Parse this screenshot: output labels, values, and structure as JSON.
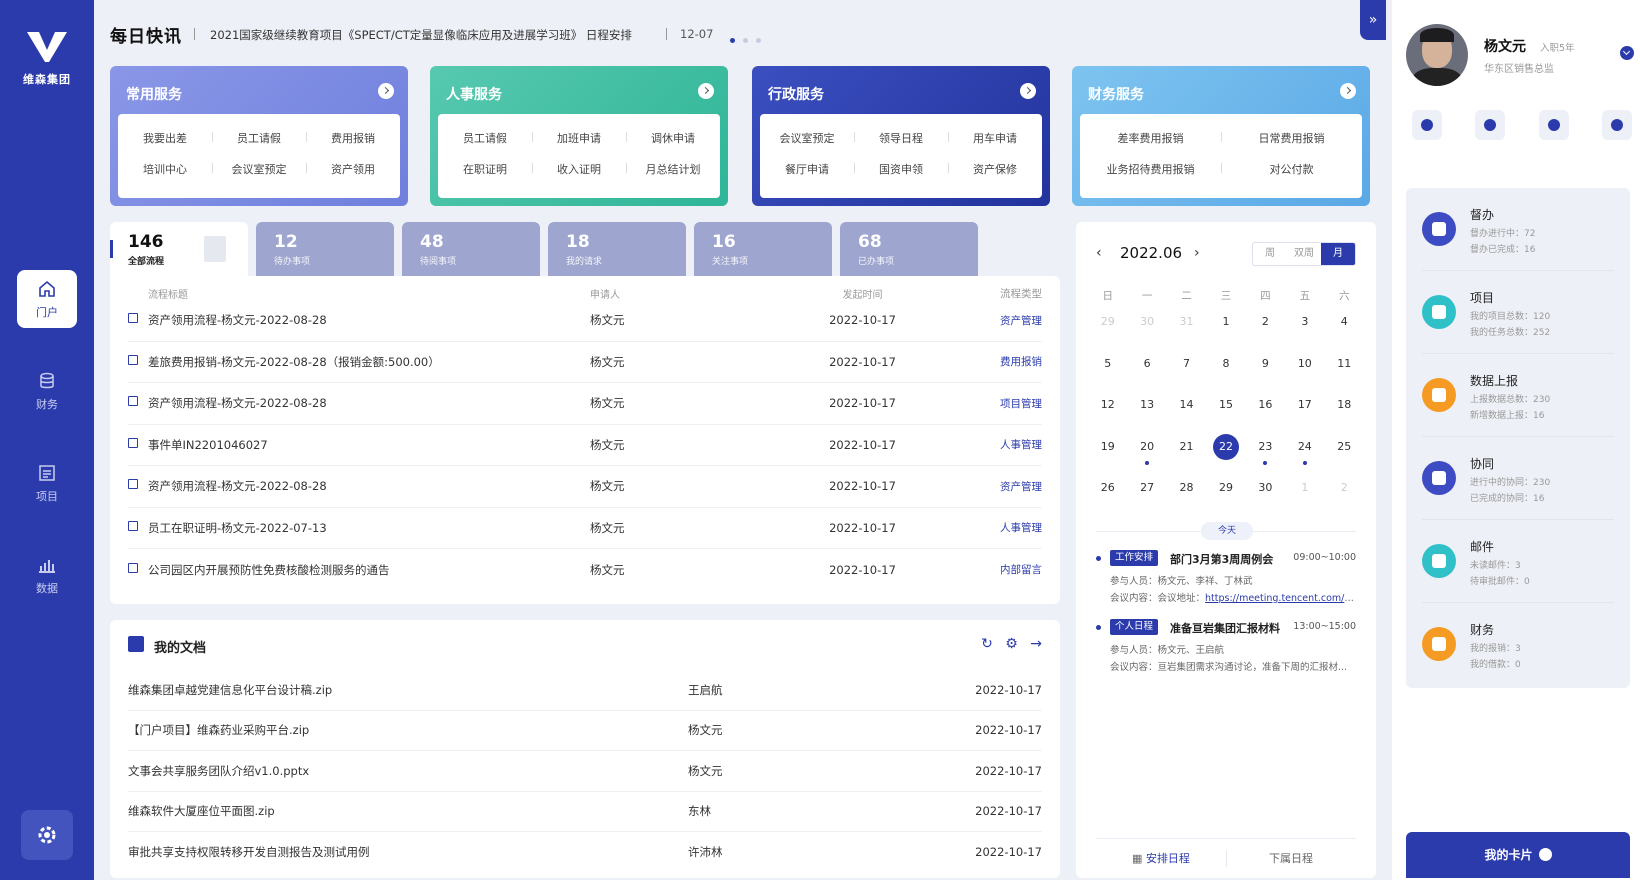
{
  "brand": {
    "logo_text": "维森集团"
  },
  "leftnav": {
    "items": [
      {
        "label": "门户",
        "icon": "home-icon",
        "active": true
      },
      {
        "label": "财务",
        "icon": "database-icon",
        "active": false
      },
      {
        "label": "项目",
        "icon": "project-icon",
        "active": false
      },
      {
        "label": "数据",
        "icon": "bar-chart-icon",
        "active": false
      }
    ],
    "settings_icon": "gear-icon"
  },
  "news": {
    "title": "每日快讯",
    "text": "2021国家级继续教育项目《SPECT/CT定量显像临床应用及进展学习班》 日程安排",
    "date": "12-07"
  },
  "expand_label": "»",
  "services": [
    {
      "title": "常用服务",
      "links": [
        [
          "我要出差",
          "员工请假",
          "费用报销"
        ],
        [
          "培训中心",
          "会议室预定",
          "资产领用"
        ]
      ]
    },
    {
      "title": "人事服务",
      "links": [
        [
          "员工请假",
          "加班申请",
          "调休申请"
        ],
        [
          "在职证明",
          "收入证明",
          "月总结计划"
        ]
      ]
    },
    {
      "title": "行政服务",
      "links": [
        [
          "会议室预定",
          "领导日程",
          "用车申请"
        ],
        [
          "餐厅申请",
          "国资申领",
          "资产保修"
        ]
      ]
    },
    {
      "title": "财务服务",
      "links": [
        [
          "差率费用报销",
          "日常费用报销"
        ],
        [
          "业务招待费用报销",
          "对公付款"
        ]
      ]
    }
  ],
  "process_tabs": [
    {
      "num": "146",
      "label": "全部流程",
      "active": true
    },
    {
      "num": "12",
      "label": "待办事项"
    },
    {
      "num": "48",
      "label": "待阅事项"
    },
    {
      "num": "18",
      "label": "我的请求"
    },
    {
      "num": "16",
      "label": "关注事项"
    },
    {
      "num": "68",
      "label": "已办事项"
    }
  ],
  "process_table": {
    "headers": {
      "title": "流程标题",
      "user": "申请人",
      "time": "发起时间",
      "type": "流程类型"
    },
    "rows": [
      {
        "title": "资产领用流程-杨文元-2022-08-28",
        "user": "杨文元",
        "time": "2022-10-17",
        "type": "资产管理"
      },
      {
        "title": "差旅费用报销-杨文元-2022-08-28（报销金额:500.00）",
        "user": "杨文元",
        "time": "2022-10-17",
        "type": "费用报销"
      },
      {
        "title": "资产领用流程-杨文元-2022-08-28",
        "user": "杨文元",
        "time": "2022-10-17",
        "type": "项目管理"
      },
      {
        "title": "事件单IN2201046027",
        "user": "杨文元",
        "time": "2022-10-17",
        "type": "人事管理"
      },
      {
        "title": "资产领用流程-杨文元-2022-08-28",
        "user": "杨文元",
        "time": "2022-10-17",
        "type": "资产管理"
      },
      {
        "title": "员工在职证明-杨文元-2022-07-13",
        "user": "杨文元",
        "time": "2022-10-17",
        "type": "人事管理"
      },
      {
        "title": "公司园区内开展预防性免费核酸检测服务的通告",
        "user": "杨文元",
        "time": "2022-10-17",
        "type": "内部留言"
      }
    ]
  },
  "docs": {
    "title": "我的文档",
    "tools": [
      "↻",
      "⚙",
      "→"
    ],
    "rows": [
      {
        "name": "维森集团卓越党建信息化平台设计稿.zip",
        "user": "王启航",
        "date": "2022-10-17"
      },
      {
        "name": "【门户项目】维森药业采购平台.zip",
        "user": "杨文元",
        "date": "2022-10-17"
      },
      {
        "name": "文事会共享服务团队介绍v1.0.pptx",
        "user": "杨文元",
        "date": "2022-10-17"
      },
      {
        "name": "维森软件大厦座位平面图.zip",
        "user": "东林",
        "date": "2022-10-17"
      },
      {
        "name": "审批共享支持权限转移开发自测报告及测试用例",
        "user": "许沛林",
        "date": "2022-10-17"
      }
    ]
  },
  "calendar": {
    "month": "2022.06",
    "prev": "‹",
    "next": "›",
    "views": [
      "周",
      "双周",
      "月"
    ],
    "active_view": "月",
    "weekdays": [
      "日",
      "一",
      "二",
      "三",
      "四",
      "五",
      "六"
    ],
    "weeks": [
      [
        [
          "29",
          "muted"
        ],
        [
          "30",
          "muted"
        ],
        [
          "31",
          "muted"
        ],
        [
          "1",
          ""
        ],
        [
          "2",
          ""
        ],
        [
          "3",
          ""
        ],
        [
          "4",
          ""
        ]
      ],
      [
        [
          "5",
          ""
        ],
        [
          "6",
          ""
        ],
        [
          "7",
          ""
        ],
        [
          "8",
          ""
        ],
        [
          "9",
          ""
        ],
        [
          "10",
          ""
        ],
        [
          "11",
          ""
        ]
      ],
      [
        [
          "12",
          ""
        ],
        [
          "13",
          ""
        ],
        [
          "14",
          ""
        ],
        [
          "15",
          ""
        ],
        [
          "16",
          ""
        ],
        [
          "17",
          ""
        ],
        [
          "18",
          ""
        ]
      ],
      [
        [
          "19",
          ""
        ],
        [
          "20",
          "dot"
        ],
        [
          "21",
          ""
        ],
        [
          "22",
          "today"
        ],
        [
          "23",
          "dot"
        ],
        [
          "24",
          "dot"
        ],
        [
          "25",
          ""
        ]
      ],
      [
        [
          "26",
          ""
        ],
        [
          "27",
          ""
        ],
        [
          "28",
          ""
        ],
        [
          "29",
          ""
        ],
        [
          "30",
          ""
        ],
        [
          "1",
          "muted"
        ],
        [
          "2",
          "muted"
        ]
      ]
    ],
    "today_label": "今天",
    "events": [
      {
        "tag": "工作安排",
        "title": "部门3月第3周周例会",
        "time": "09:00~10:00",
        "participants": "参与人员：杨文元、李祥、丁林武",
        "content_label": "会议内容：会议地址：",
        "content_link": "https://meeting.tencent.com/dm..."
      },
      {
        "tag": "个人日程",
        "title": "准备亘岩集团汇报材料",
        "time": "13:00~15:00",
        "participants": "参与人员：杨文元、王启航",
        "content_label": "会议内容：亘岩集团需求沟通讨论，准备下周的汇报材...",
        "content_link": ""
      }
    ],
    "footer": [
      "安排日程",
      "下属日程"
    ]
  },
  "profile": {
    "name": "杨文元",
    "tenure": "入职5年",
    "role": "华东区销售总监",
    "quick_icons": [
      "chat-icon",
      "bell-icon",
      "mail-icon",
      "star-icon"
    ],
    "cards": [
      {
        "title": "督办",
        "l1": "督办进行中：72",
        "l2": "督办已完成：16",
        "color": "#3d4cc2"
      },
      {
        "title": "项目",
        "l1": "我的项目总数：120",
        "l2": "我的任务总数：252",
        "color": "#2fc0c8"
      },
      {
        "title": "数据上报",
        "l1": "上报数据总数：230",
        "l2": "新增数据上报：16",
        "color": "#f59a23"
      },
      {
        "title": "协同",
        "l1": "进行中的协同：230",
        "l2": "已完成的协同：16",
        "color": "#3d4cc2"
      },
      {
        "title": "邮件",
        "l1": "未读邮件：3",
        "l2": "待审批邮件：0",
        "color": "#2fc0c8"
      },
      {
        "title": "财务",
        "l1": "我的报销：3",
        "l2": "我的借款：0",
        "color": "#f59a23"
      }
    ],
    "my_card": "我的卡片"
  }
}
